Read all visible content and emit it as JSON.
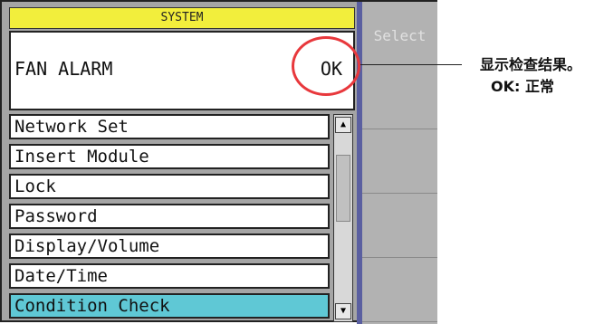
{
  "header": {
    "title": "SYSTEM"
  },
  "status": {
    "label": "FAN ALARM",
    "value": "OK"
  },
  "menu": {
    "items": [
      {
        "label": "Network Set"
      },
      {
        "label": "Insert Module"
      },
      {
        "label": "Lock"
      },
      {
        "label": "Password"
      },
      {
        "label": "Display/Volume"
      },
      {
        "label": "Date/Time"
      },
      {
        "label": "Condition Check"
      }
    ],
    "selected": "Condition Check"
  },
  "softkeys": {
    "items": [
      {
        "label": "Select"
      },
      {
        "label": ""
      },
      {
        "label": ""
      },
      {
        "label": ""
      },
      {
        "label": ""
      }
    ]
  },
  "annotation": {
    "line1": "显示检查结果。",
    "line2": "OK: 正常"
  },
  "colors": {
    "title_bar": "#f2ee3c",
    "selected_item": "#5fc8d5",
    "highlight_ring": "#e8383c",
    "divider": "#5a5fa0"
  },
  "icons": {
    "scroll_up": "triangle-up-icon",
    "scroll_down": "triangle-down-icon"
  }
}
